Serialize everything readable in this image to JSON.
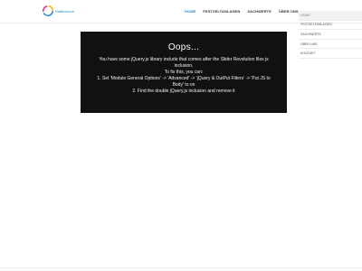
{
  "logo": {
    "text": "Staffmeo.ch"
  },
  "topnav": [
    "HOME",
    "FESTZELTANLAGEN",
    "SACHWERTE",
    "ÜBER UNS"
  ],
  "error": {
    "title": "Oops...",
    "lines": [
      "You have some jQuery.js library include that comes after the Slider Revolution files js inclusion.",
      "To fix this, you can:",
      "1. Set 'Module General Options' -> 'Advanced' -> 'jQuery & OutPut Filters' -> 'Put JS to Body' to on",
      "2. Find the double jQuery.js inclusion and remove it"
    ]
  },
  "sidebar": [
    "HOME",
    "FESTZELTANLAGEN",
    "SACHWERTE",
    "ÜBER UNS",
    "KONTAKT"
  ],
  "colors": {
    "accent": "#2a8fc4",
    "error_bg": "#111111"
  }
}
